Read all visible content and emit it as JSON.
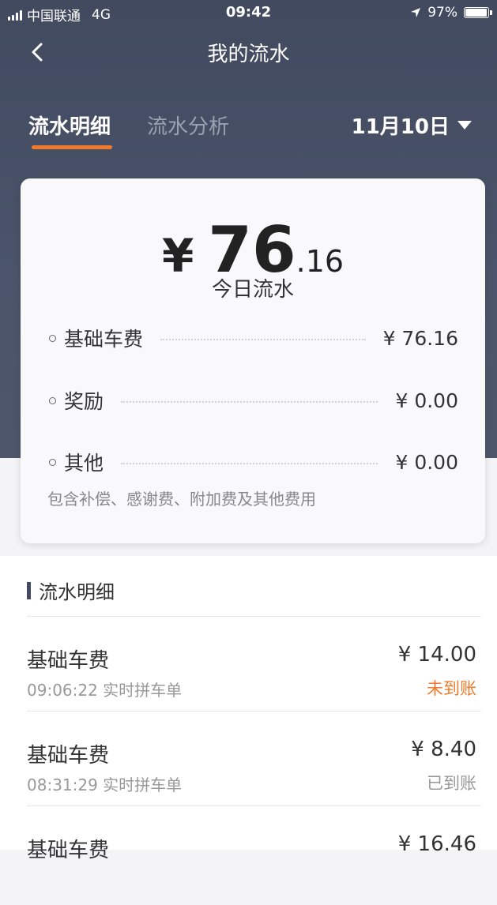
{
  "status_bar": {
    "carrier": "中国联通",
    "network": "4G",
    "time": "09:42",
    "battery": "97%",
    "battery_level": 0.97
  },
  "nav": {
    "title": "我的流水",
    "back_icon": "chevron-left-icon"
  },
  "tabs": {
    "active": "流水明细",
    "inactive": "流水分析",
    "date": "11月10日"
  },
  "summary": {
    "currency": "¥",
    "amount_int": "76",
    "amount_dec": ".16",
    "label": "今日流水",
    "rows": [
      {
        "label": "基础车费",
        "value": "¥ 76.16"
      },
      {
        "label": "奖励",
        "value": "¥ 0.00"
      },
      {
        "label": "其他",
        "value": "¥ 0.00"
      }
    ],
    "note": "包含补偿、感谢费、附加费及其他费用"
  },
  "details": {
    "title": "流水明细",
    "items": [
      {
        "title": "基础车费",
        "subtitle": "09:06:22 实时拼车单",
        "amount": "¥ 14.00",
        "status": "未到账",
        "status_color": "#f07a2a"
      },
      {
        "title": "基础车费",
        "subtitle": "08:31:29 实时拼车单",
        "amount": "¥ 8.40",
        "status": "已到账",
        "status_color": "#999999"
      },
      {
        "title": "基础车费",
        "subtitle": "",
        "amount": "¥ 16.46",
        "status": "",
        "status_color": "#999999"
      }
    ]
  },
  "colors": {
    "header_bg": "#444c61",
    "accent": "#f07a2a"
  }
}
